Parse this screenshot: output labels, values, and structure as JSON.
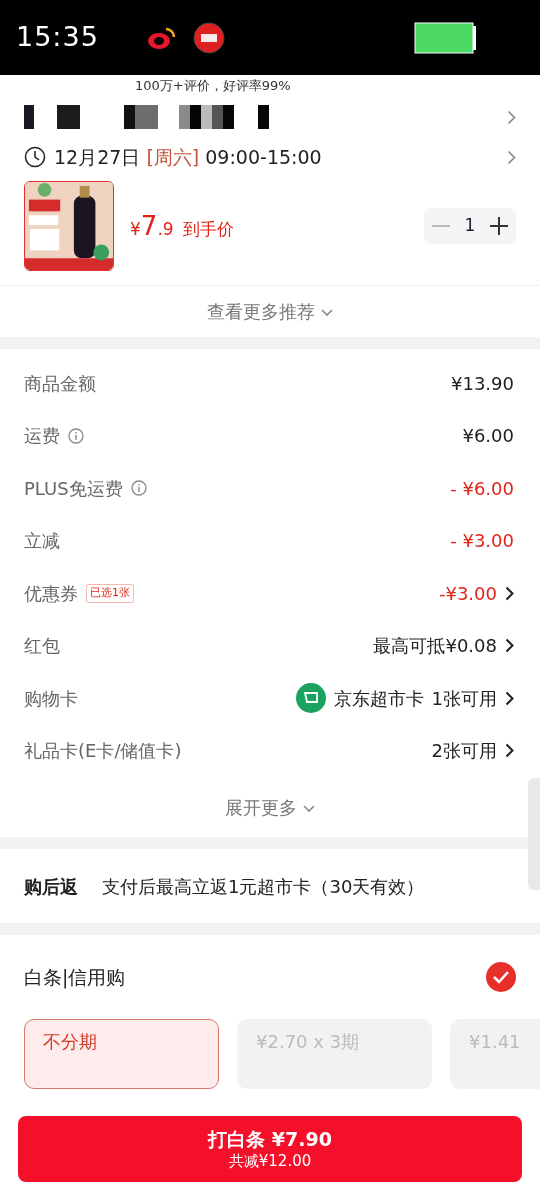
{
  "status_bar": {
    "time": "15:35"
  },
  "header_note": "100万+评价，好评率99%",
  "delivery": {
    "date": "12月27日",
    "weekday": "[周六]",
    "time": "09:00-15:00"
  },
  "product": {
    "currency": "¥",
    "price_int": "7",
    "price_dec": ".9",
    "price_label": "到手价",
    "quantity": "1"
  },
  "more_link": "查看更多推荐",
  "fees": [
    {
      "label": "商品金额",
      "info": false,
      "value": "¥13.90",
      "discount": false,
      "chevron": false
    },
    {
      "label": "运费",
      "info": true,
      "value": "¥6.00",
      "discount": false,
      "chevron": false
    },
    {
      "label": "PLUS免运费",
      "info": true,
      "value": "- ¥6.00",
      "discount": true,
      "chevron": false
    },
    {
      "label": "立减",
      "info": false,
      "value": "- ¥3.00",
      "discount": true,
      "chevron": false
    },
    {
      "label": "优惠券",
      "info": false,
      "tag": "已选1张",
      "value": "-¥3.00",
      "discount": true,
      "chevron": true
    },
    {
      "label": "红包",
      "info": false,
      "value": "最高可抵¥0.08",
      "discount": false,
      "chevron": true
    },
    {
      "label": "购物卡",
      "info": false,
      "card_name": "京东超市卡",
      "value": "1张可用",
      "discount": false,
      "chevron": true
    },
    {
      "label": "礼品卡(E卡/储值卡)",
      "info": false,
      "value": "2张可用",
      "discount": false,
      "chevron": true
    }
  ],
  "expand_link": "展开更多",
  "cashback": {
    "label": "购后返",
    "text": "支付后最高立返1元超市卡（30天有效）"
  },
  "payment": {
    "title": "白条|信用购",
    "checked": true,
    "plans": [
      {
        "label": "不分期",
        "selected": true
      },
      {
        "label": "¥2.70 x 3期",
        "selected": false
      },
      {
        "label": "¥1.41",
        "selected": false
      }
    ]
  },
  "submit": {
    "label": "打白条 ¥7.90",
    "subtitle": "共减¥12.00"
  }
}
